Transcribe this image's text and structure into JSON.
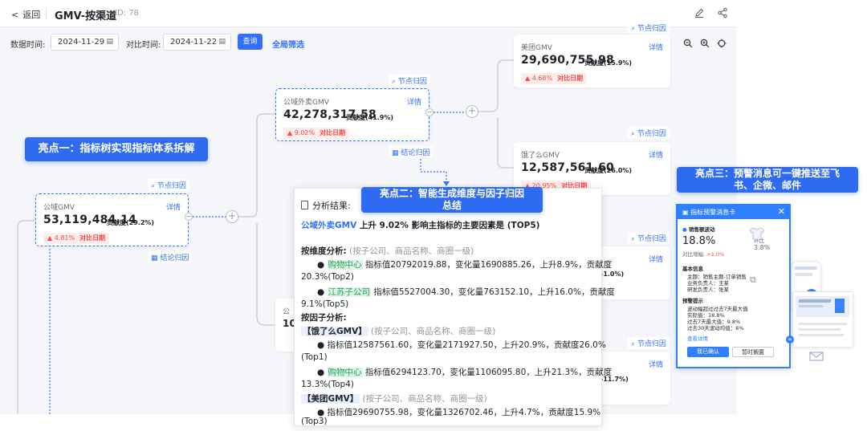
{
  "header": {
    "back_label": "返回",
    "title": "GMV-按渠道",
    "id_label": "ID: 78"
  },
  "filters": {
    "data_time_label": "数据时间:",
    "data_time_value": "2024-11-29",
    "compare_time_label": "对比时间:",
    "compare_time_value": "2024-11-22",
    "query_button": "查询",
    "global_filter": "全局筛选"
  },
  "tags": {
    "node_attribution": "节点归因",
    "conclusion_attribution": "结论归因"
  },
  "nodes": {
    "root": {
      "name": "公域GMV",
      "detail": "详情",
      "value": "53,119,484.14",
      "contrib": "贡献度(29.2%)",
      "change": "4.81%",
      "compare": "对比日期"
    },
    "takeout": {
      "name": "公域外卖GMV",
      "detail": "详情",
      "value": "42,278,317.58",
      "contrib": "贡献度(41.9%)",
      "change": "9.02%",
      "compare": "对比日期"
    },
    "meituan": {
      "name": "美团GMV",
      "detail": "详情",
      "value": "29,690,755.98",
      "contrib": "贡献度(15.9%)",
      "change": "4.68%",
      "compare": "对比日期"
    },
    "eleme": {
      "name": "饿了么GMV",
      "detail": "详情",
      "value": "12,587,561.60",
      "contrib": "贡献度(26.0%)",
      "change": "20.95%",
      "compare": "对比日期"
    },
    "partial_a": {
      "name": "公",
      "value": "10.",
      "contrib_tail": "-1.0%)",
      "detail": "详情"
    },
    "partial_b": {
      "contrib_tail": "-11.7%)",
      "detail": "详情"
    }
  },
  "highlights": {
    "one": "亮点一：指标树实现指标体系拆解",
    "two_line1": "亮点二：智能生成维度与因子归因",
    "two_line2": "总结",
    "three_line1": "亮点三：预警消息可一键推送至飞",
    "three_line2": "书、企微、邮件"
  },
  "analysis": {
    "header": "分析结果:",
    "summary_metric": "公域外卖GMV",
    "summary_text": " 上升 9.02% 影响主指标的主要因素是 (TOP5)",
    "by_dimension": "按维度分析:",
    "dim_scope": "(按子公司、商品名称、商圈一级)",
    "dim_item1_name": "购物中心",
    "dim_item1_text": " 指标值20792019.88，变化量1690885.26，上升8.9%，贡献度",
    "dim_item1_tail": "20.3%(Top2)",
    "dim_item2_name": "江苏子公司",
    "dim_item2_text": " 指标值5527004.30，变化量763152.10，上升16.0%，贡献度",
    "dim_item2_tail": "9.1%(Top5)",
    "by_factor": "按因子分析:",
    "factor1_name": "【饿了么GMV】",
    "factor1_scope": "(按子公司、商品名称、商圈一级)",
    "factor1_item_text": "指标值12587561.60，变化量2171927.50，上升20.9%，贡献度26.0%",
    "factor1_item_tail": "(Top1)",
    "factor1_item2_name": "购物中心",
    "factor1_item2_text": " 指标值6294123.70，变化量1106095.80，上升21.3%，贡献度",
    "factor1_item2_tail": "13.3%(Top4)",
    "factor2_name": "【美团GMV】",
    "factor2_scope": "(按子公司、商品名称、商圈一级)",
    "factor2_item_text": "指标值29690755.98，变化量1326702.46，上升4.7%，贡献度15.9%",
    "factor2_item_tail": "(Top3)"
  },
  "notice": {
    "title": "指标预警消息卡",
    "metric_label": "销售额波动",
    "value": "18.8%",
    "compare_label": "对比增幅:",
    "compare_value": "+1.0%",
    "ring_label": "环比",
    "ring_value": "3.8%",
    "basic_info": "基本信息",
    "subject": "主题：销售主题-订单销售",
    "owner": "业务负责人：王某",
    "dev_owner": "研发负责人：张某",
    "warning_tips": "预警提示",
    "tip1": "波动幅超过过去7天最大值",
    "tip2": "实际值：18.8%",
    "tip3": "过去7天最大值：9.8%",
    "tip4": "过去30天波动均值：6%",
    "details_link": "查看详情",
    "confirm_button": "我已确认",
    "later_button": "暂时搁置"
  },
  "colors": {
    "accent": "#3370ff",
    "highlight_banner": "#2f6bf0",
    "up_red": "#f54a45",
    "green": "#21a35b"
  }
}
